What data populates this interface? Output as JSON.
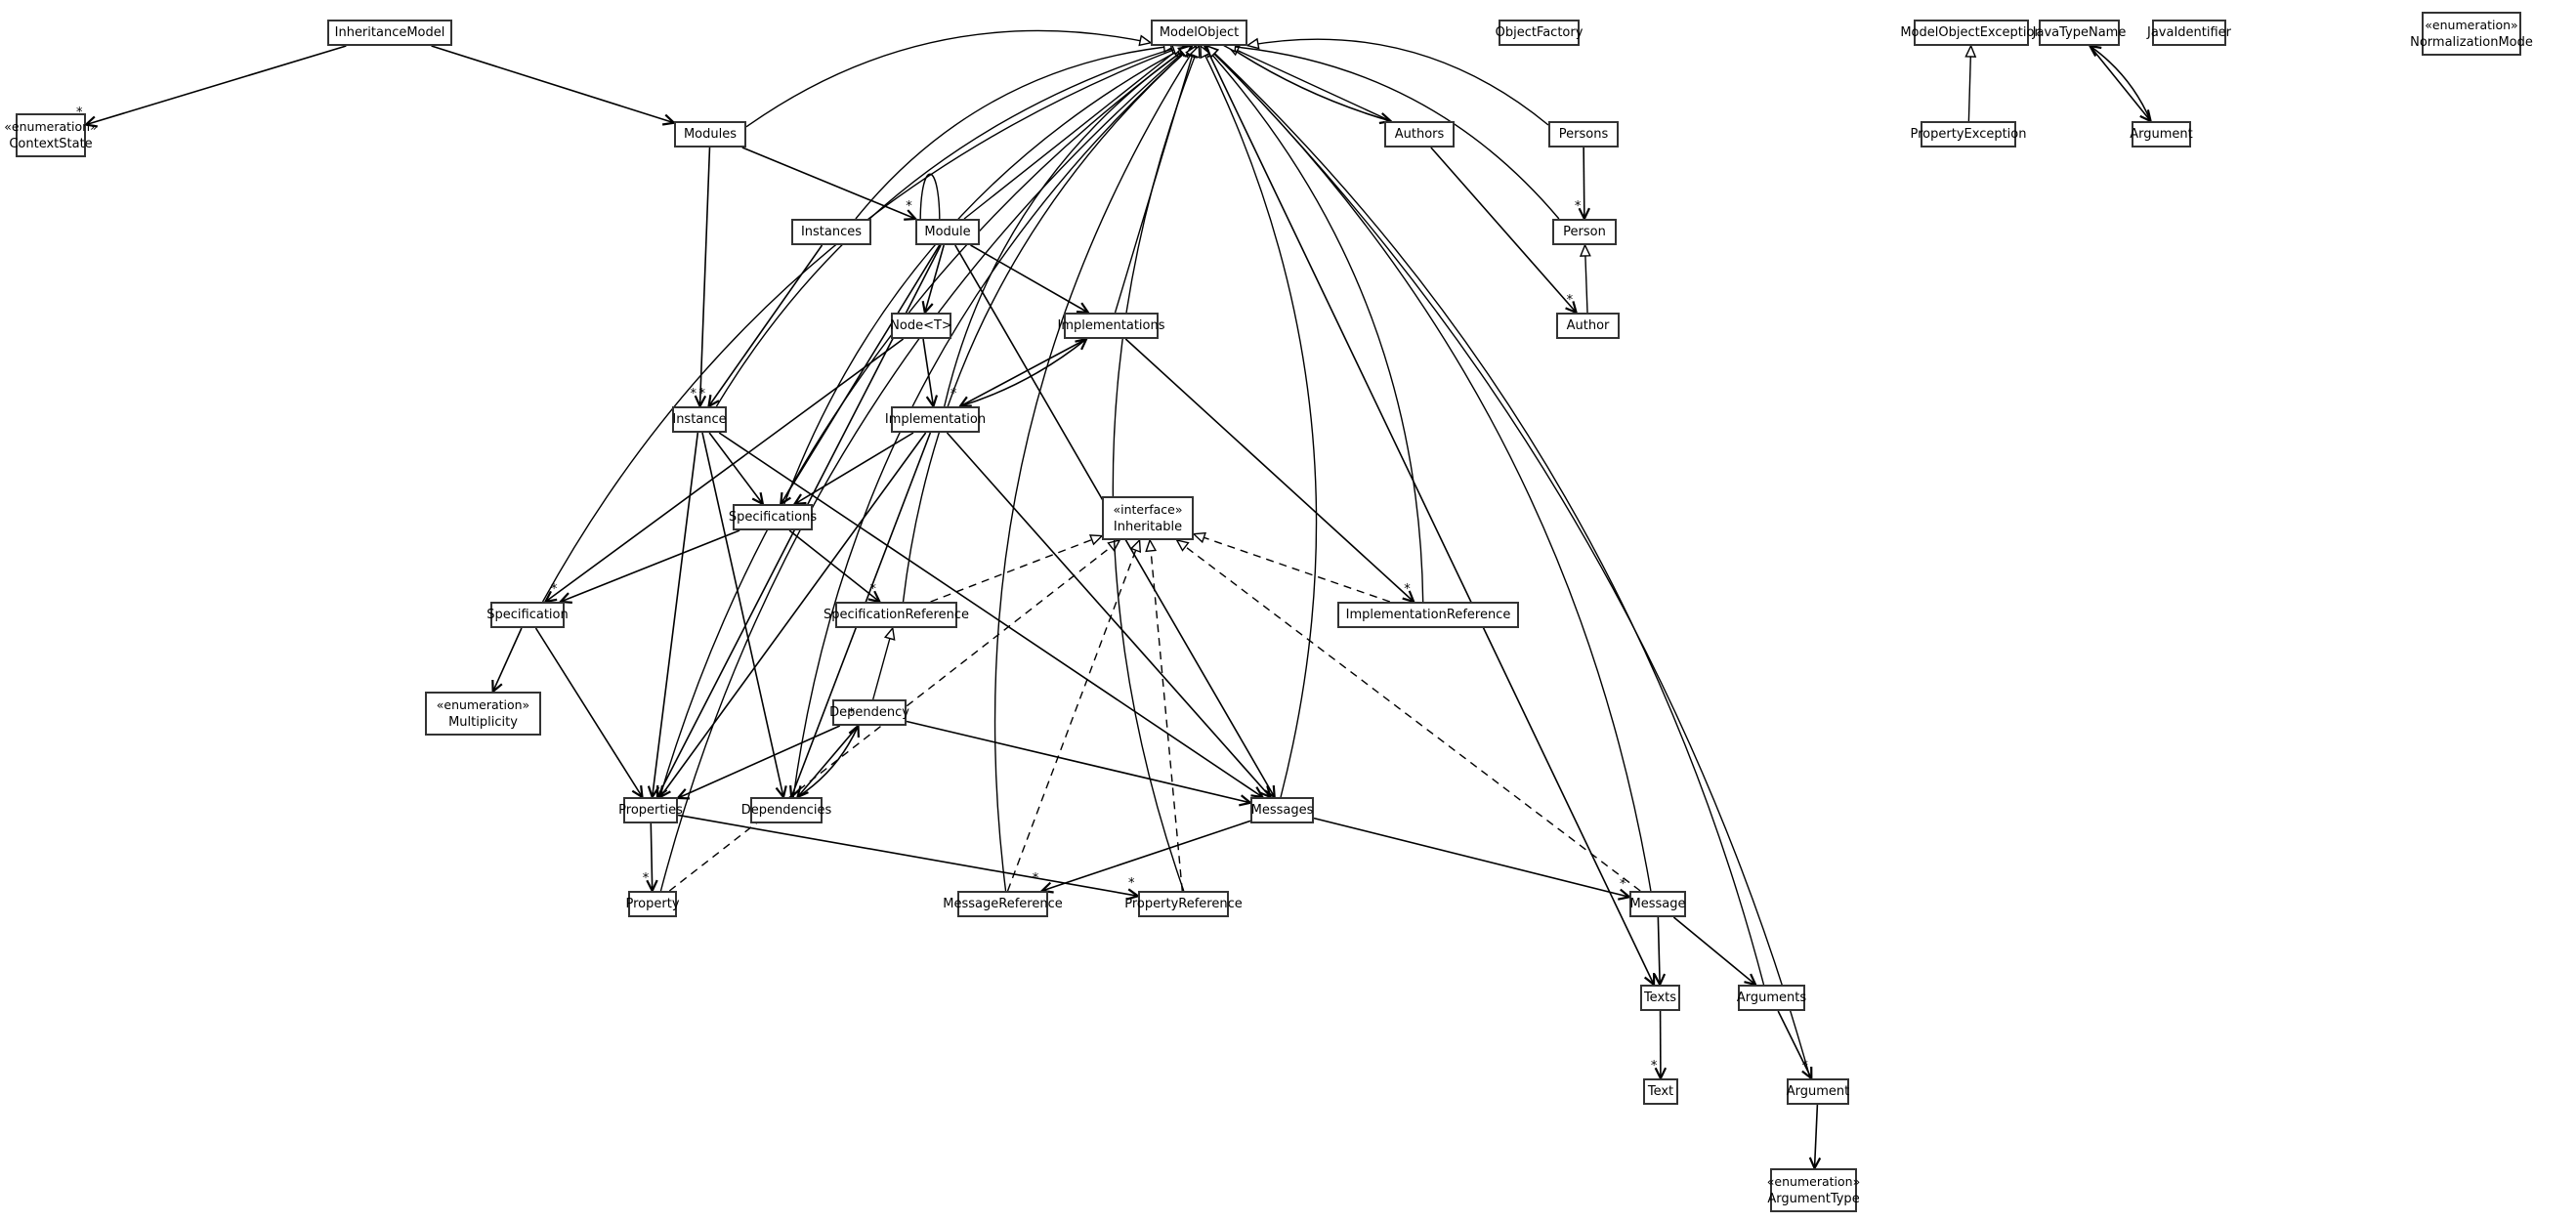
{
  "diagram": {
    "type": "UML class diagram",
    "classes": [
      {
        "id": "InheritanceModel",
        "name": "InheritanceModel",
        "stereotype": ""
      },
      {
        "id": "ModelObject",
        "name": "ModelObject",
        "stereotype": ""
      },
      {
        "id": "ObjectFactory",
        "name": "ObjectFactory",
        "stereotype": ""
      },
      {
        "id": "ModelObjectException",
        "name": "ModelObjectException",
        "stereotype": ""
      },
      {
        "id": "JavaTypeName",
        "name": "JavaTypeName",
        "stereotype": ""
      },
      {
        "id": "JavaIdentifier",
        "name": "JavaIdentifier",
        "stereotype": ""
      },
      {
        "id": "NormalizationMode",
        "name": "NormalizationMode",
        "stereotype": "«enumeration»"
      },
      {
        "id": "ContextState",
        "name": "ContextState",
        "stereotype": "«enumeration»"
      },
      {
        "id": "Modules",
        "name": "Modules",
        "stereotype": ""
      },
      {
        "id": "Authors",
        "name": "Authors",
        "stereotype": ""
      },
      {
        "id": "Persons",
        "name": "Persons",
        "stereotype": ""
      },
      {
        "id": "PropertyException",
        "name": "PropertyException",
        "stereotype": ""
      },
      {
        "id": "JTNArgument",
        "name": "Argument",
        "stereotype": ""
      },
      {
        "id": "Instances",
        "name": "Instances",
        "stereotype": ""
      },
      {
        "id": "Module",
        "name": "Module",
        "stereotype": ""
      },
      {
        "id": "Person",
        "name": "Person",
        "stereotype": ""
      },
      {
        "id": "NodeT",
        "name": "Node<T>",
        "stereotype": ""
      },
      {
        "id": "Implementations",
        "name": "Implementations",
        "stereotype": ""
      },
      {
        "id": "Author",
        "name": "Author",
        "stereotype": ""
      },
      {
        "id": "Instance",
        "name": "Instance",
        "stereotype": ""
      },
      {
        "id": "Implementation",
        "name": "Implementation",
        "stereotype": ""
      },
      {
        "id": "Specifications",
        "name": "Specifications",
        "stereotype": ""
      },
      {
        "id": "Inheritable",
        "name": "Inheritable",
        "stereotype": "«interface»"
      },
      {
        "id": "Specification",
        "name": "Specification",
        "stereotype": ""
      },
      {
        "id": "SpecificationReference",
        "name": "SpecificationReference",
        "stereotype": ""
      },
      {
        "id": "ImplementationReference",
        "name": "ImplementationReference",
        "stereotype": ""
      },
      {
        "id": "Multiplicity",
        "name": "Multiplicity",
        "stereotype": "«enumeration»"
      },
      {
        "id": "Dependency",
        "name": "Dependency",
        "stereotype": ""
      },
      {
        "id": "Properties",
        "name": "Properties",
        "stereotype": ""
      },
      {
        "id": "Dependencies",
        "name": "Dependencies",
        "stereotype": ""
      },
      {
        "id": "Messages",
        "name": "Messages",
        "stereotype": ""
      },
      {
        "id": "Property",
        "name": "Property",
        "stereotype": ""
      },
      {
        "id": "MessageReference",
        "name": "MessageReference",
        "stereotype": ""
      },
      {
        "id": "PropertyReference",
        "name": "PropertyReference",
        "stereotype": ""
      },
      {
        "id": "Message",
        "name": "Message",
        "stereotype": ""
      },
      {
        "id": "Texts",
        "name": "Texts",
        "stereotype": ""
      },
      {
        "id": "Arguments",
        "name": "Arguments",
        "stereotype": ""
      },
      {
        "id": "Text",
        "name": "Text",
        "stereotype": ""
      },
      {
        "id": "Argument",
        "name": "Argument",
        "stereotype": ""
      },
      {
        "id": "ArgumentType",
        "name": "ArgumentType",
        "stereotype": "«enumeration»"
      }
    ],
    "relations": [
      {
        "from": "InheritanceModel",
        "to": "ContextState",
        "kind": "association",
        "mult": "*"
      },
      {
        "from": "InheritanceModel",
        "to": "Modules",
        "kind": "association",
        "mult": ""
      },
      {
        "from": "Modules",
        "to": "ModelObject",
        "kind": "generalization"
      },
      {
        "from": "Modules",
        "to": "Module",
        "kind": "association",
        "mult": "*"
      },
      {
        "from": "Modules",
        "to": "Instance",
        "kind": "association",
        "mult": "*"
      },
      {
        "from": "Authors",
        "to": "ModelObject",
        "kind": "generalization"
      },
      {
        "from": "ModelObject",
        "to": "Authors",
        "kind": "association",
        "mult": ""
      },
      {
        "from": "Authors",
        "to": "Author",
        "kind": "association",
        "mult": "*"
      },
      {
        "from": "Persons",
        "to": "ModelObject",
        "kind": "generalization"
      },
      {
        "from": "Persons",
        "to": "Person",
        "kind": "association",
        "mult": "*"
      },
      {
        "from": "Person",
        "to": "ModelObject",
        "kind": "generalization"
      },
      {
        "from": "Author",
        "to": "Person",
        "kind": "generalization"
      },
      {
        "from": "PropertyException",
        "to": "ModelObjectException",
        "kind": "generalization"
      },
      {
        "from": "JavaTypeName",
        "to": "JTNArgument",
        "kind": "association",
        "mult": ""
      },
      {
        "from": "JTNArgument",
        "to": "JavaTypeName",
        "kind": "association",
        "mult": ""
      },
      {
        "from": "Instances",
        "to": "ModelObject",
        "kind": "generalization"
      },
      {
        "from": "Instances",
        "to": "Instance",
        "kind": "association",
        "mult": "*"
      },
      {
        "from": "Module",
        "to": "ModelObject",
        "kind": "generalization"
      },
      {
        "from": "Module",
        "to": "NodeT",
        "kind": "association",
        "mult": ""
      },
      {
        "from": "Module",
        "to": "Implementations",
        "kind": "association",
        "mult": ""
      },
      {
        "from": "Module",
        "to": "Messages",
        "kind": "association",
        "mult": ""
      },
      {
        "from": "Module",
        "to": "Properties",
        "kind": "association",
        "mult": ""
      },
      {
        "from": "Module",
        "to": "Specifications",
        "kind": "association",
        "mult": ""
      },
      {
        "from": "NodeT",
        "to": "Implementation",
        "kind": "association",
        "mult": ""
      },
      {
        "from": "NodeT",
        "to": "Specification",
        "kind": "association",
        "mult": ""
      },
      {
        "from": "Implementations",
        "to": "ModelObject",
        "kind": "generalization"
      },
      {
        "from": "Implementations",
        "to": "Implementation",
        "kind": "association",
        "mult": "*"
      },
      {
        "from": "Implementations",
        "to": "ImplementationReference",
        "kind": "association",
        "mult": "*"
      },
      {
        "from": "Implementation",
        "to": "Implementations",
        "kind": "association",
        "mult": ""
      },
      {
        "from": "Implementation",
        "to": "ModelObject",
        "kind": "generalization"
      },
      {
        "from": "Implementation",
        "to": "Specifications",
        "kind": "association",
        "mult": ""
      },
      {
        "from": "Implementation",
        "to": "Properties",
        "kind": "association",
        "mult": ""
      },
      {
        "from": "Implementation",
        "to": "Dependencies",
        "kind": "association",
        "mult": ""
      },
      {
        "from": "Implementation",
        "to": "Messages",
        "kind": "association",
        "mult": ""
      },
      {
        "from": "Instance",
        "to": "ModelObject",
        "kind": "generalization"
      },
      {
        "from": "Instance",
        "to": "Specifications",
        "kind": "association",
        "mult": ""
      },
      {
        "from": "Instance",
        "to": "Properties",
        "kind": "association",
        "mult": ""
      },
      {
        "from": "Instance",
        "to": "Messages",
        "kind": "association",
        "mult": ""
      },
      {
        "from": "Instance",
        "to": "Dependencies",
        "kind": "association",
        "mult": ""
      },
      {
        "from": "Specifications",
        "to": "ModelObject",
        "kind": "generalization"
      },
      {
        "from": "Specifications",
        "to": "Specification",
        "kind": "association",
        "mult": "*"
      },
      {
        "from": "Specifications",
        "to": "SpecificationReference",
        "kind": "association",
        "mult": "*"
      },
      {
        "from": "Specification",
        "to": "ModelObject",
        "kind": "generalization"
      },
      {
        "from": "Specification",
        "to": "Multiplicity",
        "kind": "association",
        "mult": ""
      },
      {
        "from": "Specification",
        "to": "Properties",
        "kind": "association",
        "mult": ""
      },
      {
        "from": "SpecificationReference",
        "to": "ModelObject",
        "kind": "generalization"
      },
      {
        "from": "SpecificationReference",
        "to": "Inheritable",
        "kind": "realization"
      },
      {
        "from": "ImplementationReference",
        "to": "ModelObject",
        "kind": "generalization"
      },
      {
        "from": "ImplementationReference",
        "to": "Inheritable",
        "kind": "realization"
      },
      {
        "from": "Dependency",
        "to": "SpecificationReference",
        "kind": "generalization"
      },
      {
        "from": "Dependency",
        "to": "Properties",
        "kind": "association",
        "mult": ""
      },
      {
        "from": "Dependency",
        "to": "Dependencies",
        "kind": "association",
        "mult": ""
      },
      {
        "from": "Dependency",
        "to": "Messages",
        "kind": "association",
        "mult": ""
      },
      {
        "from": "Dependencies",
        "to": "Dependency",
        "kind": "association",
        "mult": "*"
      },
      {
        "from": "Dependencies",
        "to": "ModelObject",
        "kind": "generalization"
      },
      {
        "from": "Properties",
        "to": "ModelObject",
        "kind": "generalization"
      },
      {
        "from": "Properties",
        "to": "Property",
        "kind": "association",
        "mult": "*"
      },
      {
        "from": "Properties",
        "to": "PropertyReference",
        "kind": "association",
        "mult": "*"
      },
      {
        "from": "Messages",
        "to": "ModelObject",
        "kind": "generalization"
      },
      {
        "from": "Messages",
        "to": "MessageReference",
        "kind": "association",
        "mult": "*"
      },
      {
        "from": "Messages",
        "to": "Message",
        "kind": "association",
        "mult": "*"
      },
      {
        "from": "Property",
        "to": "ModelObject",
        "kind": "generalization"
      },
      {
        "from": "Property",
        "to": "Inheritable",
        "kind": "realization"
      },
      {
        "from": "MessageReference",
        "to": "ModelObject",
        "kind": "generalization"
      },
      {
        "from": "MessageReference",
        "to": "Inheritable",
        "kind": "realization"
      },
      {
        "from": "PropertyReference",
        "to": "ModelObject",
        "kind": "generalization"
      },
      {
        "from": "PropertyReference",
        "to": "Inheritable",
        "kind": "realization"
      },
      {
        "from": "Message",
        "to": "ModelObject",
        "kind": "generalization"
      },
      {
        "from": "Message",
        "to": "Inheritable",
        "kind": "realization"
      },
      {
        "from": "Message",
        "to": "Texts",
        "kind": "association",
        "mult": ""
      },
      {
        "from": "Message",
        "to": "Arguments",
        "kind": "association",
        "mult": ""
      },
      {
        "from": "Texts",
        "to": "Text",
        "kind": "association",
        "mult": "*"
      },
      {
        "from": "ModelObject",
        "to": "Texts",
        "kind": "association",
        "mult": ""
      },
      {
        "from": "Arguments",
        "to": "ModelObject",
        "kind": "generalization"
      },
      {
        "from": "Arguments",
        "to": "Argument",
        "kind": "association",
        "mult": "*"
      },
      {
        "from": "Argument",
        "to": "ModelObject",
        "kind": "generalization"
      },
      {
        "from": "Argument",
        "to": "ArgumentType",
        "kind": "association",
        "mult": ""
      }
    ]
  }
}
